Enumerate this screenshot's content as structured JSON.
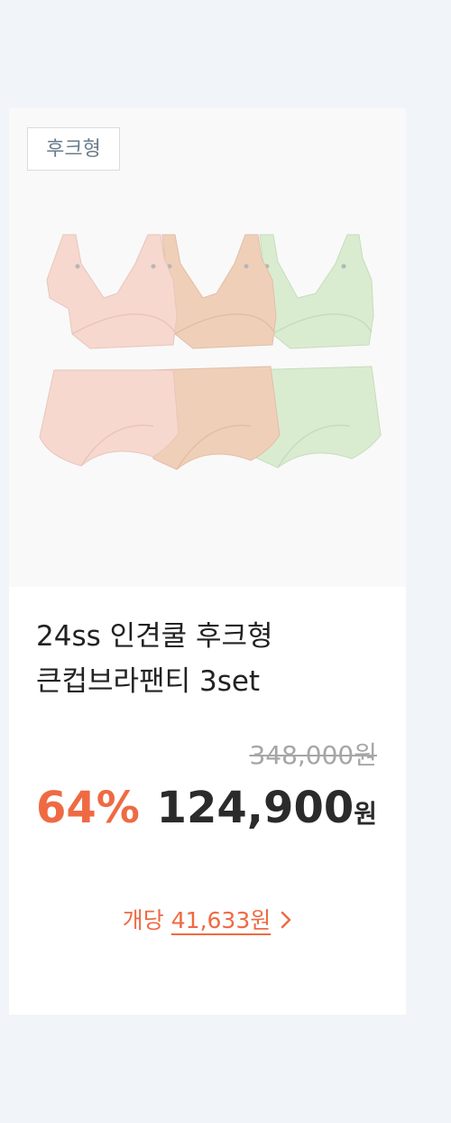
{
  "product": {
    "badge": "후크형",
    "title_line1": "24ss 인견쿨 후크형",
    "title_line2": "큰컵브라팬티 3set",
    "original_price": "348,000원",
    "discount": "64%",
    "sale_price": "124,900",
    "currency": "원",
    "unit_label": "개당",
    "unit_price": "41,633원"
  },
  "colors": {
    "accent": "#ef6a43",
    "price_text": "#2b2b2b",
    "strikethrough": "#a6a6a6",
    "page_bg": "#f1f5fa",
    "set_colors": [
      "#f6d8cf",
      "#f0cfb8",
      "#d9ecd0"
    ]
  },
  "icons": {
    "unit_link": "chevron-right-icon"
  }
}
